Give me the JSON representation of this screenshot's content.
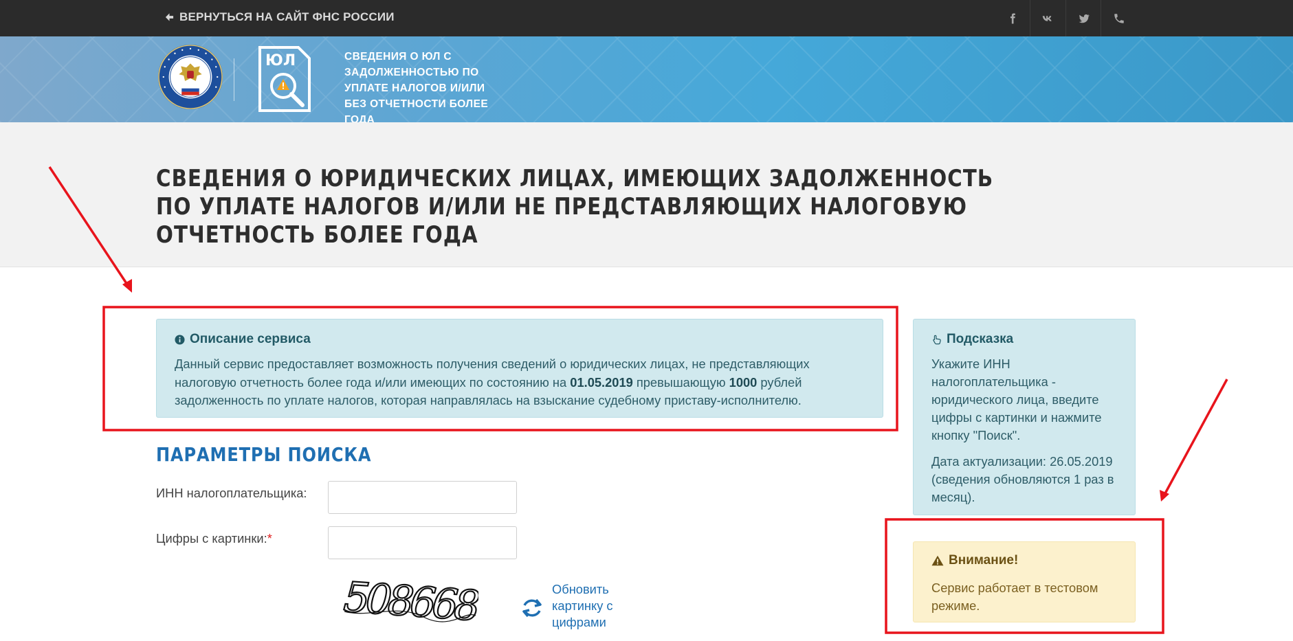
{
  "topbar": {
    "back_label": "ВЕРНУТЬСЯ НА САЙТ ФНС РОССИИ",
    "social": [
      "facebook-icon",
      "vk-icon",
      "twitter-icon",
      "phone-icon"
    ]
  },
  "banner": {
    "service_title": "СВЕДЕНИЯ О ЮЛ С ЗАДОЛЖЕННОСТЬЮ ПО УПЛАТЕ НАЛОГОВ И/ИЛИ БЕЗ ОТЧЕТНОСТИ БОЛЕЕ ГОДА",
    "logo_badge_text": "ЮЛ"
  },
  "page": {
    "title": "СВЕДЕНИЯ О ЮРИДИЧЕСКИХ ЛИЦАХ, ИМЕЮЩИХ ЗАДОЛЖЕННОСТЬ ПО УПЛАТЕ НАЛОГОВ И/ИЛИ НЕ ПРЕДСТАВЛЯЮЩИХ НАЛОГОВУЮ ОТЧЕТНОСТЬ БОЛЕЕ ГОДА"
  },
  "description": {
    "heading": "Описание сервиса",
    "text_part1": "Данный сервис предоставляет возможность получения сведений о юридических лицах, не представляющих налоговую отчетность более года и/или имеющих по состоянию на ",
    "date": "01.05.2019",
    "text_part2": " превышающую ",
    "amount": "1000",
    "text_part3": " рублей задолженность по уплате налогов, которая направлялась на взыскание судебному приставу-исполнителю."
  },
  "hint": {
    "heading": "Подсказка",
    "text": "Укажите ИНН налогоплательщика - юридического лица, введите цифры с картинки и нажмите кнопку \"Поиск\".",
    "update_info": "Дата актуализации: 26.05.2019 (сведения обновляются 1 раз в месяц)."
  },
  "warning": {
    "heading": "Внимание!",
    "text": "Сервис работает в тестовом режиме."
  },
  "search": {
    "title": "ПАРАМЕТРЫ ПОИСКА",
    "inn_label": "ИНН налогоплательщика:",
    "inn_value": "",
    "digits_label": "Цифры с картинки:",
    "required_mark": "*",
    "digits_value": "",
    "captcha_text": "508668",
    "refresh_label": "Обновить картинку с цифрами"
  },
  "colors": {
    "topbar": "#2b2b2b",
    "accent_blue": "#1f6fb2",
    "info_bg": "#d1e9ee",
    "warning_bg": "#fcf1cd",
    "annotation_red": "#e8141c"
  }
}
